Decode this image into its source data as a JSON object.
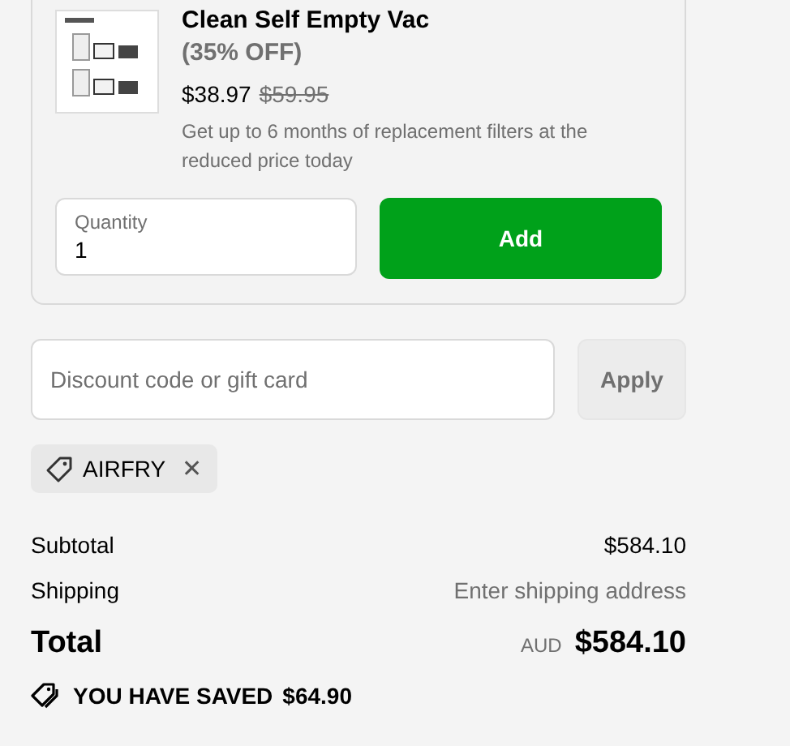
{
  "offer": {
    "title": "Clean Self Empty Vac",
    "discount": "(35% OFF)",
    "price": "$38.97",
    "original_price": "$59.95",
    "description": "Get up to 6 months of replacement filters at the reduced price today",
    "quantity": {
      "label": "Quantity",
      "value": "1"
    },
    "add_button": "Add"
  },
  "discount_field": {
    "placeholder": "Discount code or gift card"
  },
  "apply_button": {
    "label": "Apply",
    "disabled": true
  },
  "applied_codes": [
    {
      "code": "AIRFRY",
      "remove": "✕"
    }
  ],
  "summary": [
    {
      "label": "Subtotal",
      "value": "$584.10",
      "kind": "amount"
    },
    {
      "label": "Shipping",
      "value": "Enter shipping address",
      "kind": "hint"
    }
  ],
  "total": {
    "label": "Total",
    "currency": "AUD",
    "value": "$584.10"
  },
  "savings": {
    "label": "YOU HAVE SAVED",
    "value": "$64.90"
  }
}
